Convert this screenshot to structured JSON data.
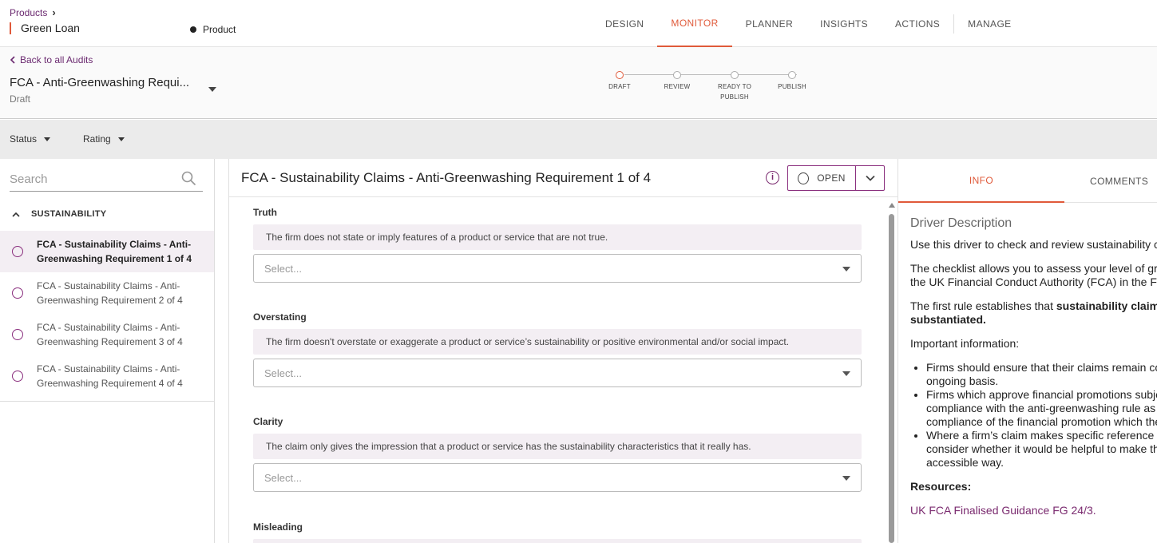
{
  "header": {
    "breadcrumb": "Products",
    "product_name": "Green Loan",
    "product_type": "Product",
    "nav": [
      "DESIGN",
      "MONITOR",
      "PLANNER",
      "INSIGHTS",
      "ACTIONS",
      "MANAGE"
    ],
    "active_nav": "MONITOR"
  },
  "audit": {
    "back_label": "Back to all Audits",
    "title": "FCA - Anti-Greenwashing Requi...",
    "status": "Draft",
    "steps": [
      "DRAFT",
      "REVIEW",
      "READY TO PUBLISH",
      "PUBLISH"
    ],
    "active_step": "DRAFT"
  },
  "filters": {
    "status_label": "Status",
    "rating_label": "Rating"
  },
  "sidebar": {
    "search_placeholder": "Search",
    "group": "SUSTAINABILITY",
    "items": [
      {
        "label": "FCA - Sustainability Claims - Anti-Greenwashing Requirement 1 of 4",
        "selected": true
      },
      {
        "label": "FCA - Sustainability Claims - Anti-Greenwashing Requirement 2 of 4",
        "selected": false
      },
      {
        "label": "FCA - Sustainability Claims - Anti-Greenwashing Requirement 3 of 4",
        "selected": false
      },
      {
        "label": "FCA - Sustainability Claims - Anti-Greenwashing Requirement 4 of 4",
        "selected": false
      }
    ]
  },
  "main": {
    "title": "FCA - Sustainability Claims - Anti-Greenwashing Requirement 1 of 4",
    "info_icon": "i",
    "status_button": "OPEN",
    "select_placeholder": "Select...",
    "questions": [
      {
        "title": "Truth",
        "description": "The firm does not state or imply features of a product or service that are not true."
      },
      {
        "title": "Overstating",
        "description": "The firm doesn't overstate or exaggerate a product or service’s sustainability or positive environmental and/or social impact."
      },
      {
        "title": "Clarity",
        "description": "The claim only gives the impression that a product or service has the sustainability characteristics that it really has."
      },
      {
        "title": "Misleading",
        "description": ""
      }
    ]
  },
  "right_panel": {
    "tabs": [
      "INFO",
      "COMMENTS"
    ],
    "active_tab": "INFO",
    "heading": "Driver Description",
    "p1": "Use this driver to check and review sustainability claims",
    "p2a": "The checklist allows you to assess your level of greenwashing",
    "p2b": "the UK Financial Conduct Authority (FCA) in the Finalised",
    "p3a": "The first rule establishes that ",
    "p3b": "sustainability claims should be",
    "p3c": "substantiated.",
    "important": "Important information:",
    "bullets": [
      [
        "Firms should ensure that their claims remain correct on an",
        "ongoing basis."
      ],
      [
        "Firms which approve financial promotions subject to",
        "compliance with the anti-greenwashing rule as part of",
        "compliance of the financial promotion which they approve."
      ],
      [
        "Where a firm’s claim makes specific reference to",
        "consider whether it would be helpful to make that",
        "accessible way."
      ]
    ],
    "resources": "Resources:",
    "resource_link": "UK FCA Finalised Guidance FG 24/3."
  },
  "colors": {
    "accent": "#e05a3a",
    "brand_purple": "#7a2a6f",
    "selected_bg": "#f3eef3"
  }
}
